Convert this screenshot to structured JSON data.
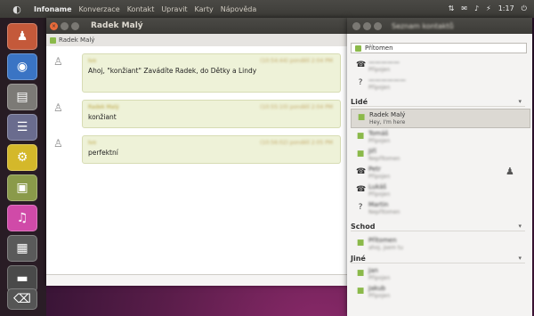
{
  "top_panel": {
    "app_name": "Infoname",
    "menus": [
      "Konverzace",
      "Kontakt",
      "Upravit",
      "Karty",
      "Nápověda"
    ],
    "clock": "1:17",
    "indicators": [
      "⇅",
      "✉",
      "♪",
      "⚡"
    ]
  },
  "chat": {
    "title": "Radek Malý",
    "tab_label": "Radek Malý",
    "messages": [
      {
        "sender": "Ivo",
        "timestamp": "(10:54:44)  pondělí 2:04 PM",
        "text": "Ahoj, \"konžiant\" Zavádíte Radek, do Dětky a Lindy"
      },
      {
        "sender": "Radek Malý",
        "timestamp": "(10:55:10)  pondělí 2:04 PM",
        "text": "konžiant"
      },
      {
        "sender": "Ivo",
        "timestamp": "(10:56:02)  pondělí 2:05 PM",
        "text": "perfektní"
      }
    ]
  },
  "contacts": {
    "title": "Seznam kontaktů",
    "status": "Přítomen",
    "top_entries": [
      {
        "name": "—————",
        "status": "Připojen"
      },
      {
        "name": "——————",
        "status": "Připojen"
      }
    ],
    "groups": [
      {
        "name": "Lidé",
        "arrow": "▾"
      },
      {
        "name": "Schod",
        "arrow": "▾"
      },
      {
        "name": "Jiné",
        "arrow": "▾"
      }
    ],
    "selected": {
      "name": "Radek Malý",
      "status": "Hey, I'm here"
    },
    "people_contacts": [
      {
        "name": "Tomáš",
        "status": "Připojen"
      },
      {
        "name": "Jiří",
        "status": "Nepřítomen"
      },
      {
        "name": "Petr",
        "status": "Připojen"
      },
      {
        "name": "Lukáš",
        "status": "Připojen"
      },
      {
        "name": "Martin",
        "status": "Nepřítomen"
      }
    ],
    "schod_contacts": [
      {
        "name": "Přítomen",
        "status": "ahoj, jsem tu"
      }
    ],
    "other_contacts": [
      {
        "name": "Jan",
        "status": "Připojen"
      },
      {
        "name": "Jakub",
        "status": "Připojen"
      }
    ]
  }
}
